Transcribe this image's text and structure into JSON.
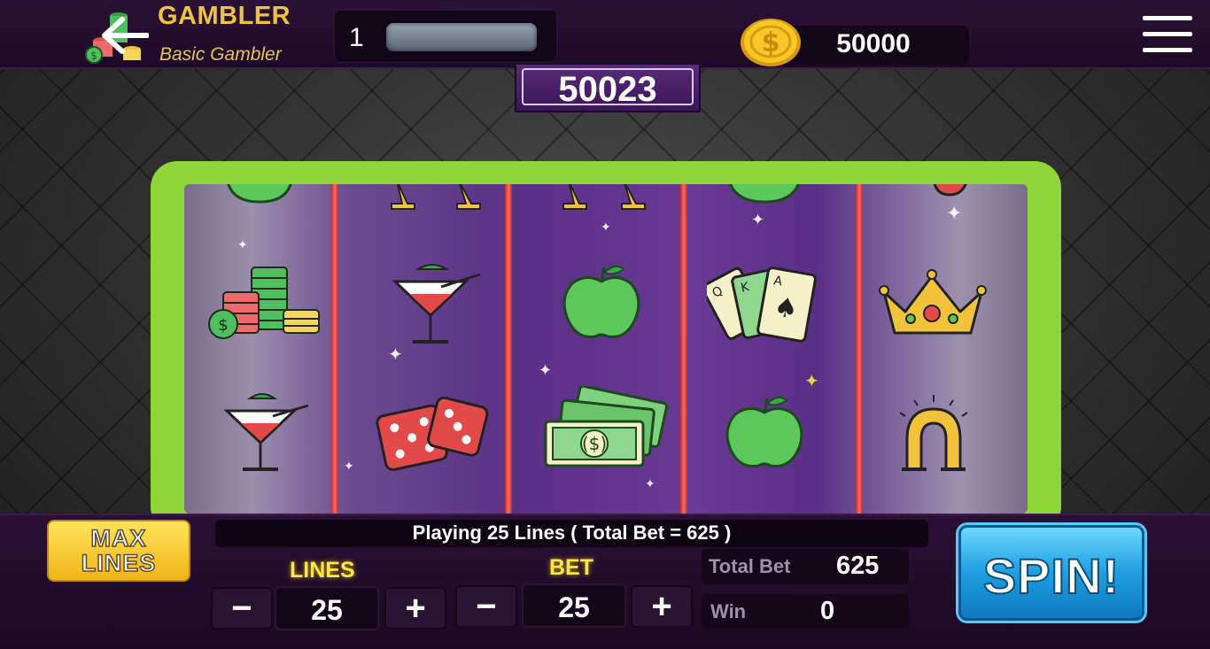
{
  "player": {
    "name": "GAMBLER",
    "rank": "Basic Gambler"
  },
  "level": {
    "value": "1",
    "xp_progress": 0
  },
  "coins": {
    "value": "50000"
  },
  "jackpot": {
    "value": "50023"
  },
  "reels": {
    "columns": [
      [
        "apple",
        "coin-stacks",
        "cocktail"
      ],
      [
        "trophy",
        "cocktail",
        "dice"
      ],
      [
        "trophy",
        "apple",
        "cash"
      ],
      [
        "apple",
        "playing-cards",
        "apple"
      ],
      [
        "cherry",
        "crown",
        "horseshoe"
      ]
    ]
  },
  "controls": {
    "max_lines_label_1": "MAX",
    "max_lines_label_2": "LINES",
    "info_text": "Playing 25 Lines ( Total Bet = 625 )",
    "lines_label": "LINES",
    "lines_value": "25",
    "bet_label": "BET",
    "bet_value": "25",
    "minus": "−",
    "plus": "+",
    "total_bet_label": "Total Bet",
    "total_bet_value": "625",
    "win_label": "Win",
    "win_value": "0",
    "spin_label": "SPIN!"
  },
  "colors": {
    "frame_green": "#8fd63b",
    "gold": "#f2c23a",
    "spin_blue": "#1e9ee0",
    "reel_divider_red": "#ff6a6a"
  }
}
